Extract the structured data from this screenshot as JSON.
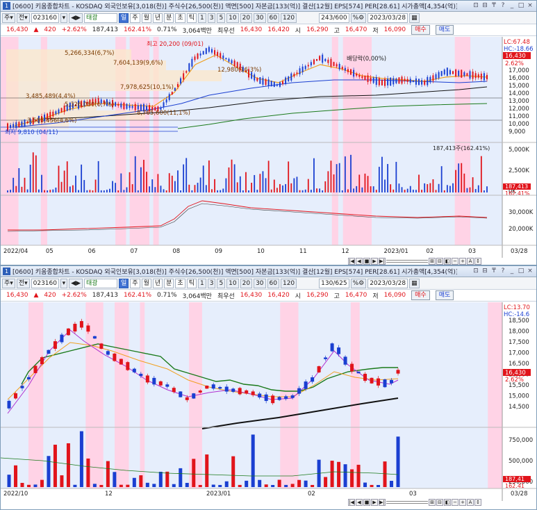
{
  "top": {
    "title": "[0600] 키움종합차트 - KOSDAQ 외국인보유[3,018(천)] 주식수[26,500(천)] 액면[500] 자본금[133(억)] 결산[12월] EPS[574] PER[28.61] 시가총액[4,354(억)] 유통비율[",
    "num": "1",
    "code": "023160",
    "name": "태광",
    "count": "243/600",
    "date": "2023/03/28",
    "periods": [
      "일",
      "주",
      "월",
      "년",
      "분",
      "초",
      "틱"
    ],
    "intervals": [
      "1",
      "3",
      "5",
      "10",
      "20",
      "30",
      "60",
      "120"
    ],
    "quote": {
      "price": "16,430",
      "arrow": "▲",
      "change": "420",
      "rate": "+2.62%",
      "volume": "187,413",
      "vol_ratio": "162.41%",
      "turnover": "0.71%",
      "amount": "3,064백만",
      "label": "최우선",
      "ask": "16,430",
      "bid": "16,420",
      "open_label": "시",
      "open": "16,290",
      "high_label": "고",
      "high": "16,470",
      "low_label": "저",
      "low": "16,090",
      "buy": "매수",
      "sell": "매도"
    },
    "annotations": {
      "high": "최고 20,200 (09/01)",
      "div": "배당락(0,00%)",
      "vp1": "5,266,334(6,7%)",
      "vp2": "7,604,139(9,6%)",
      "vp3": "3,485,489(4,4%)",
      "vp4": "7,978,625(10,1%)",
      "vp5": "5,326,080(6,7%)",
      "vp6": "8,765,600(11,1%)",
      "vp7": "3,585,456(4,6%)",
      "vp8": "12,980(16,3%)",
      "low": "최저 9,810 (04/11)"
    },
    "price_axis": [
      "17,000",
      "16,000",
      "15,000",
      "14,000",
      "13,000",
      "12,000",
      "11,000",
      "10,000",
      "9,000"
    ],
    "lc": "LC:67.48",
    "hc": "HC:-18.66",
    "cur_price": "16,430",
    "cur_rate": "2.62%",
    "vol_axis": [
      "5,000K",
      "2,500K",
      "0K"
    ],
    "vol_note": "187,413주(162.41%)",
    "vol_tag": "187,413",
    "vol_tag2": "162.41%",
    "ind_axis": [
      "30,000K",
      "20,000K"
    ],
    "xlabels": [
      "2022/04",
      "05",
      "06",
      "07",
      "08",
      "09",
      "10",
      "11",
      "12",
      "2023/01",
      "02",
      "03",
      "03/28"
    ]
  },
  "bottom": {
    "title": "[0600] 키움종합차트 - KOSDAQ 외국인보유[3,018(천)] 주식수[26,500(천)] 액면[500] 자본금[133(억)] 결산[12월] EPS[574] PER[28.61] 시가총액[4,354(억)] 유통비율[",
    "num": "1",
    "count": "130/625",
    "price_axis": [
      "18,500",
      "18,000",
      "17,500",
      "17,000",
      "16,500",
      "16,000",
      "15,500",
      "15,000",
      "14,500"
    ],
    "lc": "LC:13.70",
    "hc": "HC:-14.6",
    "cur_price": "16,430",
    "cur_rate": "2.62%",
    "vol_axis": [
      "750,000",
      "500,000",
      "250,000"
    ],
    "vol_tag": "187,41",
    "vol_tag2": "162.41",
    "xlabels": [
      "2022/10",
      "12",
      "2023/01",
      "02",
      "03",
      "03/28"
    ]
  },
  "colors": {
    "up": "#e1141b",
    "down": "#1a3fd1",
    "pinkband": "#ffd3e6",
    "blueband": "#e6eefc",
    "ma_green": "#1a7a1a",
    "ma_orange": "#f0a020"
  }
}
